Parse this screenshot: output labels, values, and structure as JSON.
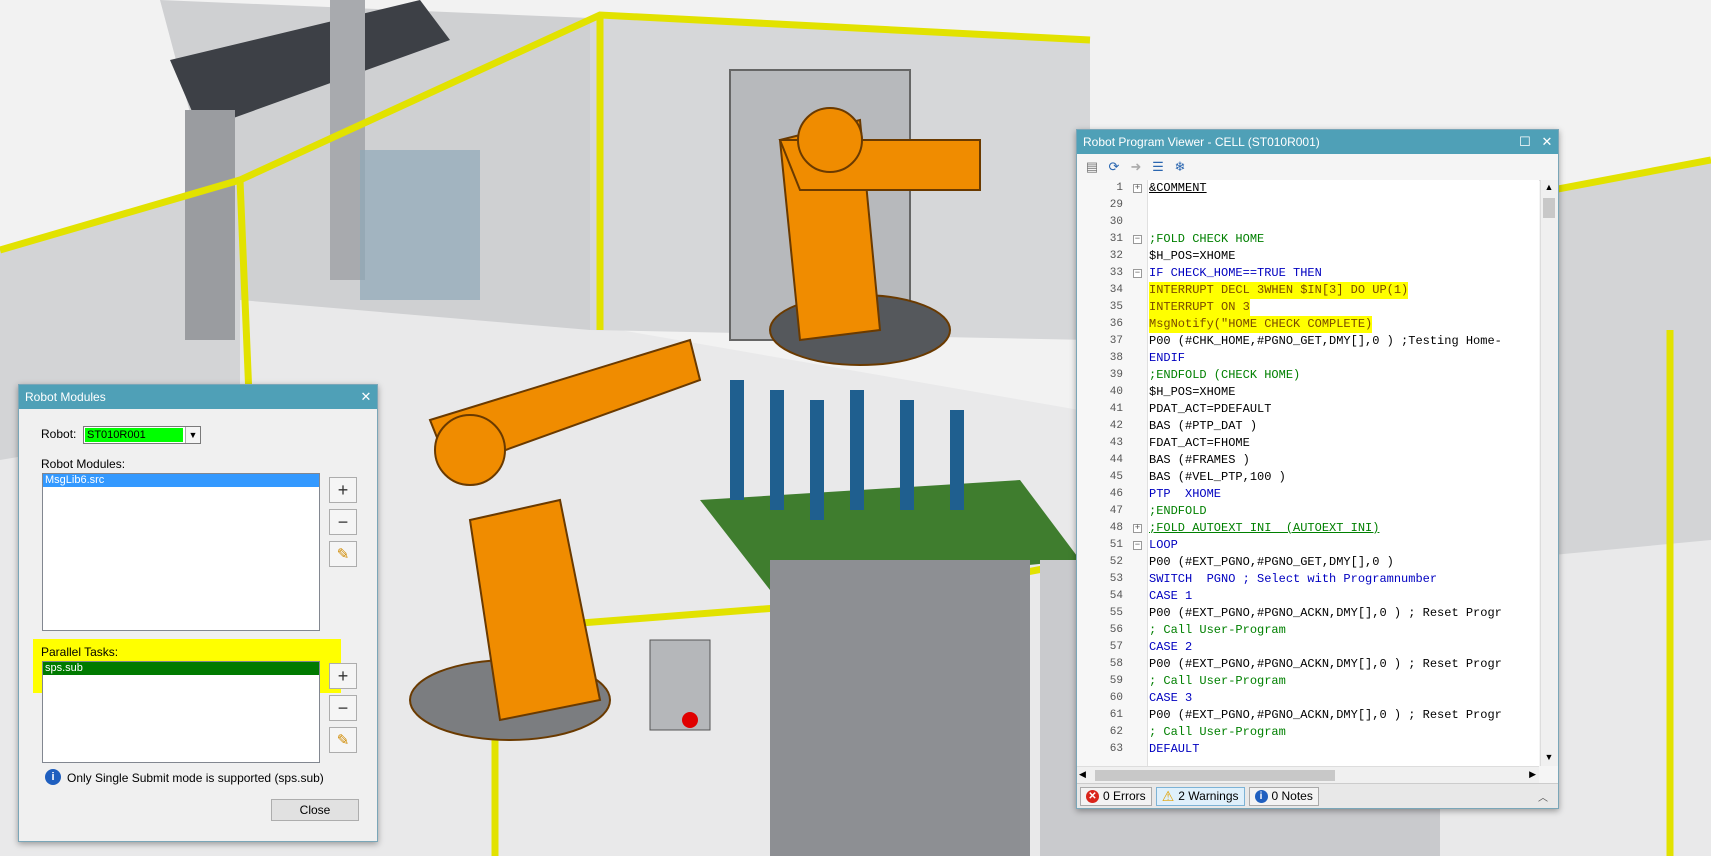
{
  "colors": {
    "title_bar": "#4fa0b7",
    "highlight_yellow": "#ffff00",
    "robot_orange": "#f08c00",
    "fence_yellow": "#e2e200",
    "selection_blue": "#3399ff",
    "parallel_green": "#007a00"
  },
  "robot_modules": {
    "title": "Robot Modules",
    "robot_label": "Robot:",
    "robot_value": "ST010R001",
    "modules_label": "Robot Modules:",
    "modules": [
      "MsgLib6.src"
    ],
    "parallel_label": "Parallel Tasks:",
    "parallel_tasks": [
      "sps.sub"
    ],
    "info_text": "Only Single Submit mode is supported (sps.sub)",
    "close_label": "Close",
    "icons": [
      "add-icon",
      "remove-icon",
      "edit-pencil-icon",
      "info-icon",
      "close-icon"
    ]
  },
  "program_viewer": {
    "title": "Robot Program Viewer  - CELL (ST010R001)",
    "toolbar_icons": [
      "new-document-icon",
      "refresh-icon",
      "forward-arrow-icon",
      "list-icon",
      "snowflake-icon"
    ],
    "lines": [
      {
        "n": "1",
        "t": "&COMMENT",
        "fold": "+"
      },
      {
        "n": "29",
        "t": ""
      },
      {
        "n": "30",
        "t": ""
      },
      {
        "n": "31",
        "t": ";FOLD CHECK HOME",
        "fold": "-"
      },
      {
        "n": "32",
        "t": "$H_POS=XHOME"
      },
      {
        "n": "33",
        "t": "IF CHECK_HOME==TRUE THEN",
        "fold": "-"
      },
      {
        "n": "34",
        "t": "INTERRUPT DECL 3WHEN $IN[3] DO UP(1)",
        "hl": true
      },
      {
        "n": "35",
        "t": "INTERRUPT ON 3",
        "hl": true
      },
      {
        "n": "36",
        "t": "MsgNotify(\"HOME CHECK COMPLETE)",
        "hl": true
      },
      {
        "n": "37",
        "t": "P00 (#CHK_HOME,#PGNO_GET,DMY[],0 ) ;Testing Home-"
      },
      {
        "n": "38",
        "t": "ENDIF"
      },
      {
        "n": "39",
        "t": ";ENDFOLD (CHECK HOME)"
      },
      {
        "n": "40",
        "t": "$H_POS=XHOME"
      },
      {
        "n": "41",
        "t": "PDAT_ACT=PDEFAULT"
      },
      {
        "n": "42",
        "t": "BAS (#PTP_DAT )"
      },
      {
        "n": "43",
        "t": "FDAT_ACT=FHOME"
      },
      {
        "n": "44",
        "t": "BAS (#FRAMES )"
      },
      {
        "n": "45",
        "t": "BAS (#VEL_PTP,100 )"
      },
      {
        "n": "46",
        "t": "PTP  XHOME"
      },
      {
        "n": "47",
        "t": ";ENDFOLD"
      },
      {
        "n": "48",
        "t": ";FOLD AUTOEXT INI  (AUTOEXT INI)",
        "fold": "+"
      },
      {
        "n": "51",
        "t": "LOOP",
        "fold": "-"
      },
      {
        "n": "52",
        "t": "P00 (#EXT_PGNO,#PGNO_GET,DMY[],0 )"
      },
      {
        "n": "53",
        "t": "SWITCH  PGNO ; Select with Programnumber"
      },
      {
        "n": "54",
        "t": "CASE 1"
      },
      {
        "n": "55",
        "t": "P00 (#EXT_PGNO,#PGNO_ACKN,DMY[],0 ) ; Reset Progr"
      },
      {
        "n": "56",
        "t": "; Call User-Program"
      },
      {
        "n": "57",
        "t": "CASE 2"
      },
      {
        "n": "58",
        "t": "P00 (#EXT_PGNO,#PGNO_ACKN,DMY[],0 ) ; Reset Progr"
      },
      {
        "n": "59",
        "t": "; Call User-Program"
      },
      {
        "n": "60",
        "t": "CASE 3"
      },
      {
        "n": "61",
        "t": "P00 (#EXT_PGNO,#PGNO_ACKN,DMY[],0 ) ; Reset Progr"
      },
      {
        "n": "62",
        "t": "; Call User-Program"
      },
      {
        "n": "63",
        "t": "DEFAULT"
      }
    ],
    "status": {
      "errors": "0 Errors",
      "warnings": "2 Warnings",
      "notes": "0 Notes"
    }
  }
}
